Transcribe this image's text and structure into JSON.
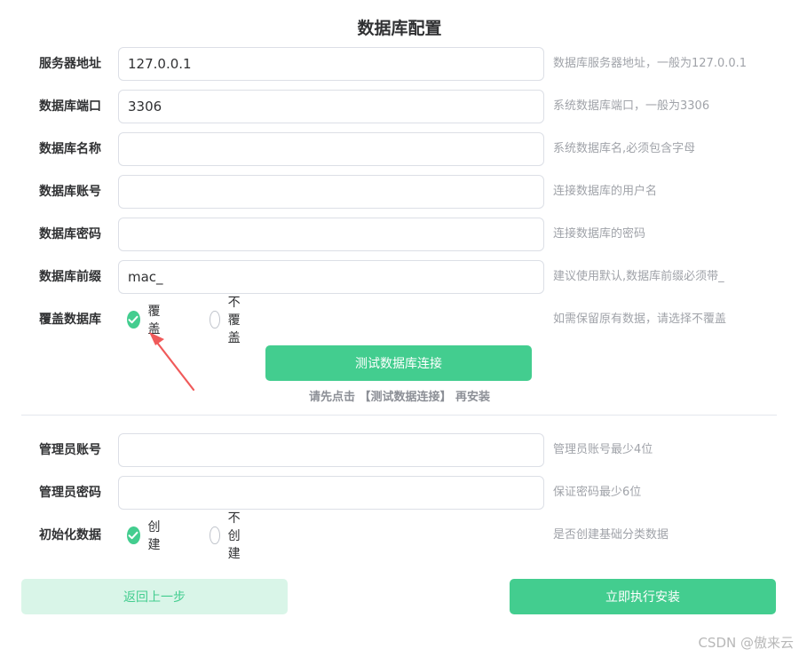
{
  "page_title": "数据库配置",
  "db_fields": [
    {
      "label": "服务器地址",
      "value": "127.0.0.1",
      "placeholder": "",
      "hint": "数据库服务器地址，一般为127.0.0.1"
    },
    {
      "label": "数据库端口",
      "value": "3306",
      "placeholder": "",
      "hint": "系统数据库端口，一般为3306"
    },
    {
      "label": "数据库名称",
      "value": "",
      "placeholder": "",
      "hint": "系统数据库名,必须包含字母"
    },
    {
      "label": "数据库账号",
      "value": "",
      "placeholder": "",
      "hint": "连接数据库的用户名"
    },
    {
      "label": "数据库密码",
      "value": "",
      "placeholder": "",
      "hint": "连接数据库的密码"
    },
    {
      "label": "数据库前缀",
      "value": "mac_",
      "placeholder": "",
      "hint": "建议使用默认,数据库前缀必须带_"
    }
  ],
  "overwrite": {
    "label": "覆盖数据库",
    "options": [
      {
        "label": "覆盖",
        "checked": true
      },
      {
        "label": "不覆盖",
        "checked": false
      }
    ],
    "hint": "如需保留原有数据，请选择不覆盖"
  },
  "test_button": {
    "label": "测试数据库连接"
  },
  "test_notice": "请先点击 【测试数据连接】 再安装",
  "admin_fields": [
    {
      "label": "管理员账号",
      "value": "",
      "placeholder": "",
      "hint": "管理员账号最少4位"
    },
    {
      "label": "管理员密码",
      "value": "",
      "placeholder": "",
      "hint": "保证密码最少6位"
    }
  ],
  "init_data": {
    "label": "初始化数据",
    "options": [
      {
        "label": "创建",
        "checked": true
      },
      {
        "label": "不创建",
        "checked": false
      }
    ],
    "hint": "是否创建基础分类数据"
  },
  "back_button": {
    "label": "返回上一步"
  },
  "install_button": {
    "label": "立即执行安装"
  },
  "watermark": "CSDN @傲来云",
  "colors": {
    "accent": "#43cd8f",
    "accent_light": "#d9f5e8",
    "annotation_arrow": "#f05a5a"
  },
  "icons": {
    "radio_checked": "check-icon",
    "annotation": "arrow-icon"
  }
}
